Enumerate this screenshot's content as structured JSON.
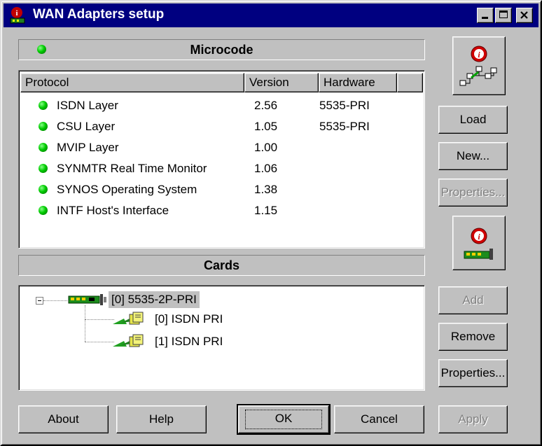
{
  "window": {
    "title": "WAN Adapters setup",
    "controls": [
      "minimize",
      "maximize",
      "close"
    ]
  },
  "microcode": {
    "group_label": "Microcode",
    "columns": [
      "Protocol",
      "Version",
      "Hardware"
    ],
    "rows": [
      {
        "protocol": "ISDN Layer",
        "version": "2.56",
        "hardware": "5535-PRI"
      },
      {
        "protocol": "CSU Layer",
        "version": "1.05",
        "hardware": "5535-PRI"
      },
      {
        "protocol": "MVIP Layer",
        "version": "1.00",
        "hardware": ""
      },
      {
        "protocol": "SYNMTR Real Time Monitor",
        "version": "1.06",
        "hardware": ""
      },
      {
        "protocol": "SYNOS Operating System",
        "version": "1.38",
        "hardware": ""
      },
      {
        "protocol": "INTF Host's Interface",
        "version": "1.15",
        "hardware": ""
      }
    ]
  },
  "cards": {
    "group_label": "Cards",
    "tree": {
      "root": "[0] 5535-2P-PRI",
      "children": [
        "[0] ISDN PRI",
        "[1] ISDN PRI"
      ]
    }
  },
  "side_buttons": {
    "load": "Load",
    "new": "New...",
    "properties_top": "Properties...",
    "add": "Add",
    "remove": "Remove",
    "properties_bottom": "Properties..."
  },
  "bottom_buttons": {
    "about": "About",
    "help": "Help",
    "ok": "OK",
    "cancel": "Cancel",
    "apply": "Apply"
  },
  "colors": {
    "titlebar": "#000080",
    "face": "#c0c0c0",
    "status_led": "#00c000"
  },
  "icons": [
    "network-info-icon",
    "card-info-icon",
    "adapter-card-icon",
    "isdn-connector-icon",
    "status-led-icon"
  ]
}
